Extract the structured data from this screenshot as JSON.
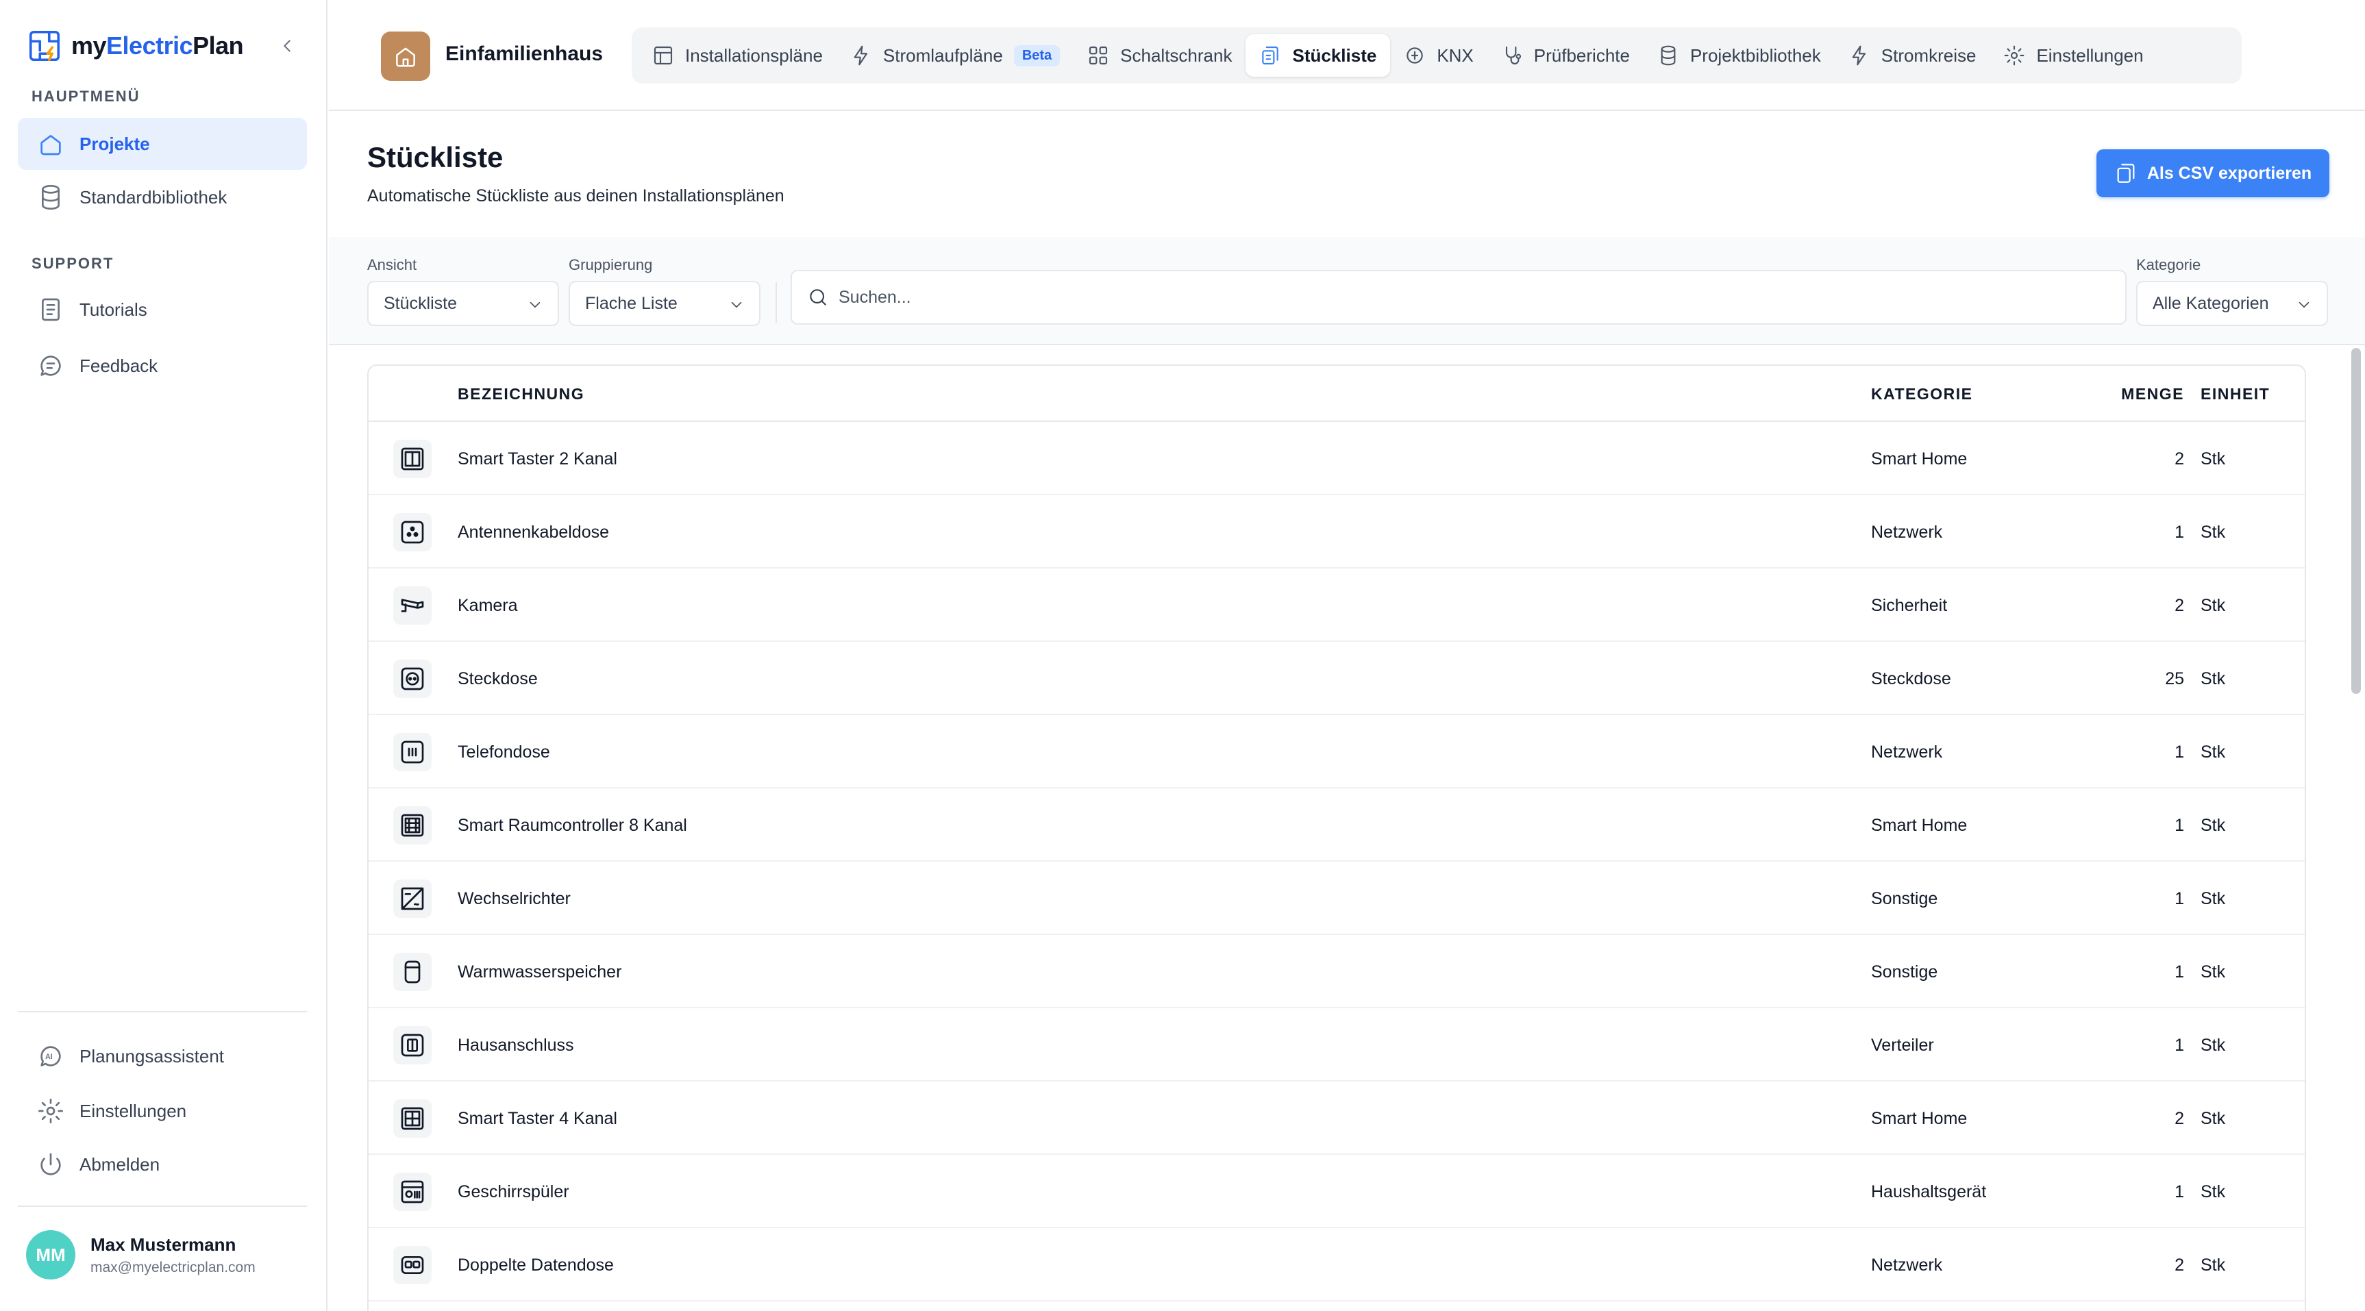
{
  "app": {
    "logo_main": "my",
    "logo_accent": "Electric",
    "logo_end": "Plan"
  },
  "sidebar": {
    "main_section": "HAUPTMENÜ",
    "main_items": [
      {
        "label": "Projekte",
        "icon": "home-icon",
        "active": true
      },
      {
        "label": "Standardbibliothek",
        "icon": "database-icon",
        "active": false
      }
    ],
    "support_section": "SUPPORT",
    "support_items": [
      {
        "label": "Tutorials",
        "icon": "tutorial-icon"
      },
      {
        "label": "Feedback",
        "icon": "chat-icon"
      }
    ],
    "bottom_items": [
      {
        "label": "Planungsassistent",
        "icon": "ai-icon"
      },
      {
        "label": "Einstellungen",
        "icon": "gear-icon"
      },
      {
        "label": "Abmelden",
        "icon": "power-icon"
      }
    ],
    "user": {
      "initials": "MM",
      "name": "Max Mustermann",
      "email": "max@myelectricplan.com"
    }
  },
  "topbar": {
    "project_name": "Einfamilienhaus",
    "tabs": [
      {
        "label": "Installationspläne",
        "icon": "layout-icon"
      },
      {
        "label": "Stromlaufpläne",
        "icon": "bolt-icon",
        "badge": "Beta"
      },
      {
        "label": "Schaltschrank",
        "icon": "grid-icon"
      },
      {
        "label": "Stückliste",
        "icon": "list-icon",
        "active": true
      },
      {
        "label": "KNX",
        "icon": "chip-icon"
      },
      {
        "label": "Prüfberichte",
        "icon": "stethoscope-icon"
      },
      {
        "label": "Projektbibliothek",
        "icon": "database-icon"
      },
      {
        "label": "Stromkreise",
        "icon": "bolt-icon"
      },
      {
        "label": "Einstellungen",
        "icon": "gear-icon"
      }
    ]
  },
  "header": {
    "title": "Stückliste",
    "subtitle": "Automatische Stückliste aus deinen Installationsplänen",
    "export_label": "Als CSV exportieren"
  },
  "filters": {
    "view_label": "Ansicht",
    "view_value": "Stückliste",
    "group_label": "Gruppierung",
    "group_value": "Flache Liste",
    "search_placeholder": "Suchen...",
    "category_label": "Kategorie",
    "category_value": "Alle Kategorien"
  },
  "table": {
    "columns": {
      "name": "BEZEICHNUNG",
      "category": "KATEGORIE",
      "quantity": "MENGE",
      "unit": "EINHEIT"
    },
    "rows": [
      {
        "name": "Smart Taster 2 Kanal",
        "category": "Smart Home",
        "quantity": "2",
        "unit": "Stk",
        "icon": "smart-button-2-icon"
      },
      {
        "name": "Antennenkabeldose",
        "category": "Netzwerk",
        "quantity": "1",
        "unit": "Stk",
        "icon": "antenna-socket-icon"
      },
      {
        "name": "Kamera",
        "category": "Sicherheit",
        "quantity": "2",
        "unit": "Stk",
        "icon": "camera-icon"
      },
      {
        "name": "Steckdose",
        "category": "Steckdose",
        "quantity": "25",
        "unit": "Stk",
        "icon": "socket-icon"
      },
      {
        "name": "Telefondose",
        "category": "Netzwerk",
        "quantity": "1",
        "unit": "Stk",
        "icon": "phone-socket-icon"
      },
      {
        "name": "Smart Raumcontroller 8 Kanal",
        "category": "Smart Home",
        "quantity": "1",
        "unit": "Stk",
        "icon": "room-controller-icon"
      },
      {
        "name": "Wechselrichter",
        "category": "Sonstige",
        "quantity": "1",
        "unit": "Stk",
        "icon": "inverter-icon"
      },
      {
        "name": "Warmwasserspeicher",
        "category": "Sonstige",
        "quantity": "1",
        "unit": "Stk",
        "icon": "water-heater-icon"
      },
      {
        "name": "Hausanschluss",
        "category": "Verteiler",
        "quantity": "1",
        "unit": "Stk",
        "icon": "house-connection-icon"
      },
      {
        "name": "Smart Taster 4 Kanal",
        "category": "Smart Home",
        "quantity": "2",
        "unit": "Stk",
        "icon": "smart-button-4-icon"
      },
      {
        "name": "Geschirrspüler",
        "category": "Haushaltsgerät",
        "quantity": "1",
        "unit": "Stk",
        "icon": "dishwasher-icon"
      },
      {
        "name": "Doppelte Datendose",
        "category": "Netzwerk",
        "quantity": "2",
        "unit": "Stk",
        "icon": "data-socket-icon"
      }
    ]
  },
  "colors": {
    "accent": "#3b82f6",
    "active_bg": "#e8f0fe",
    "avatar": "#4fd1c5",
    "project_badge": "#c08a5b"
  }
}
